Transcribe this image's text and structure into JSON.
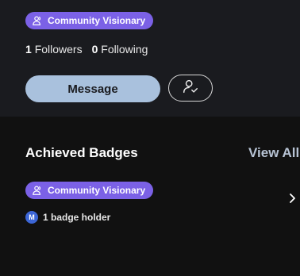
{
  "profile": {
    "badge_label": "Community Visionary",
    "followers_count": "1",
    "followers_label": "Followers",
    "following_count": "0",
    "following_label": "Following",
    "message_label": "Message"
  },
  "badges_section": {
    "title": "Achieved Badges",
    "view_all_label": "View All",
    "items": [
      {
        "badge_label": "Community Visionary",
        "holder_avatar_initial": "M",
        "holder_text": "1 badge holder"
      }
    ]
  },
  "colors": {
    "badge_bg": "#7b61e6",
    "message_bg": "#a9c1dd",
    "avatar_bg": "#3c66d6"
  },
  "icons": {
    "badge": "people-icon",
    "follow": "user-follow-icon",
    "chevron": "chevron-right-icon"
  }
}
